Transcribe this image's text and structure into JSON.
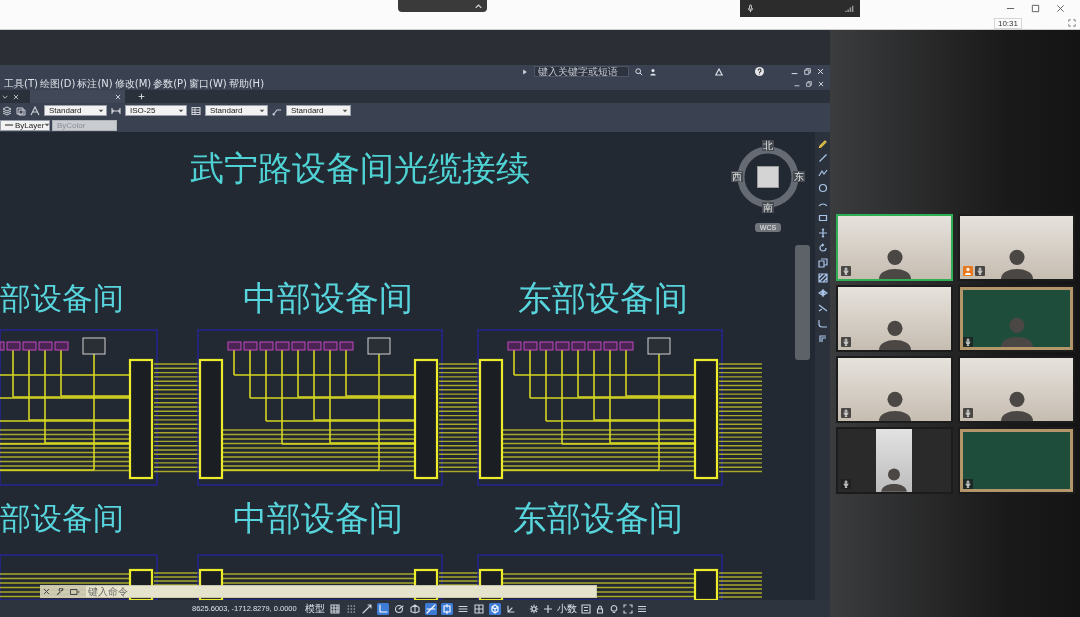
{
  "top_bar": {
    "time": "10:31"
  },
  "cad": {
    "search": {
      "placeholder": "键入关键字或短语"
    },
    "menu": [
      "工具(T)",
      "绘图(D)",
      "标注(N)",
      "修改(M)",
      "参数(P)",
      "窗口(W)",
      "帮助(H)"
    ],
    "style_combos": [
      {
        "value": "Standard"
      },
      {
        "value": "ISO-25"
      },
      {
        "value": "Standard"
      },
      {
        "value": "Standard"
      }
    ],
    "property_combos": [
      {
        "value": "ByLayer",
        "disabled": false
      },
      {
        "value": "ByColor",
        "disabled": true
      }
    ],
    "drawing": {
      "title": "武宁路设备间光缆接续",
      "rows": [
        {
          "rooms": [
            {
              "label": "部设备间"
            },
            {
              "label": "中部设备间"
            },
            {
              "label": "东部设备间"
            }
          ]
        },
        {
          "rooms": [
            {
              "label": "部设备间"
            },
            {
              "label": "中部设备间"
            },
            {
              "label": "东部设备间"
            }
          ]
        }
      ]
    },
    "view_cube": {
      "north": "北",
      "east": "东",
      "south": "南",
      "west": "西",
      "ucs": "WCS"
    },
    "command_line": {
      "placeholder": "键入命令"
    },
    "status_bar": {
      "coordinates": "8625.6003, -1712.8279, 0.0000",
      "space": "模型",
      "toggles": [
        {
          "on": false
        },
        {
          "on": false
        },
        {
          "on": false
        },
        {
          "on": true
        },
        {
          "on": false
        },
        {
          "on": false
        },
        {
          "on": true
        },
        {
          "on": true
        },
        {
          "on": false
        },
        {
          "on": false
        },
        {
          "on": true
        },
        {
          "on": false
        }
      ],
      "units": "小数"
    }
  },
  "participants": [
    {
      "kind": "room",
      "person": true,
      "speaking": true,
      "host": false
    },
    {
      "kind": "room",
      "person": true,
      "speaking": false,
      "host": true
    },
    {
      "kind": "room",
      "person": true,
      "speaking": false,
      "host": false
    },
    {
      "kind": "board",
      "person": true,
      "speaking": false,
      "host": false
    },
    {
      "kind": "room",
      "person": true,
      "speaking": false,
      "host": false
    },
    {
      "kind": "room",
      "person": true,
      "speaking": false,
      "host": false
    },
    {
      "kind": "portrait",
      "person": true,
      "speaking": false,
      "host": false
    },
    {
      "kind": "board",
      "person": false,
      "speaking": false,
      "host": false
    }
  ]
}
